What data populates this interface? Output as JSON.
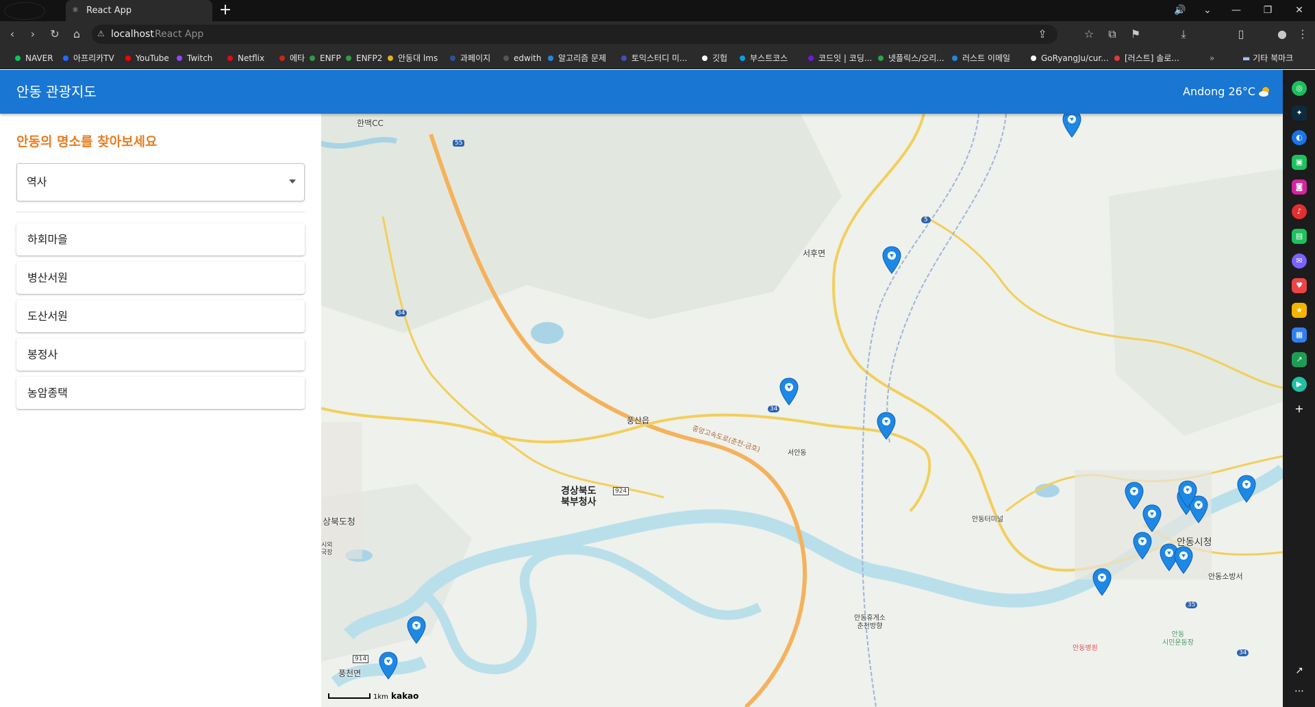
{
  "browser": {
    "tab_title": "React App",
    "url_host": "localhost",
    "url_title": "React App",
    "bookmarks": [
      {
        "label": "NAVER",
        "color": "#03c75a"
      },
      {
        "label": "아프리카TV",
        "color": "#1f6cff"
      },
      {
        "label": "YouTube",
        "color": "#ff0000"
      },
      {
        "label": "Twitch",
        "color": "#9146ff"
      },
      {
        "label": "Netflix",
        "color": "#e50914"
      },
      {
        "label": "에타",
        "color": "#c62917"
      },
      {
        "label": "ENFP",
        "color": "#2d9c4a"
      },
      {
        "label": "ENFP2",
        "color": "#2d9c4a"
      },
      {
        "label": "안동대 lms",
        "color": "#e0b020"
      },
      {
        "label": "과페이지",
        "color": "#3050a0"
      },
      {
        "label": "edwith",
        "color": "#555555"
      },
      {
        "label": "알고리즘 문제",
        "color": "#1e88e5"
      },
      {
        "label": "토익스터디 미...",
        "color": "#3f51b5"
      },
      {
        "label": "깃헙",
        "color": "#ffffff"
      },
      {
        "label": "부스트코스",
        "color": "#00a0e9"
      },
      {
        "label": "코드잇 | 코딩...",
        "color": "#6a1bde"
      },
      {
        "label": "넷플릭스/오리...",
        "color": "#2aa44a"
      },
      {
        "label": "러스트 이메일",
        "color": "#1e88e5"
      },
      {
        "label": "GoRyangJu/cur...",
        "color": "#ffffff"
      },
      {
        "label": "[러스트] 솔로...",
        "color": "#e53935"
      }
    ],
    "other_bookmarks": "기타 북마크"
  },
  "app": {
    "title": "안동 관광지도",
    "weather": "Andong 26°C",
    "sidebar_heading": "안동의 명소를 찾아보세요",
    "category_selected": "역사",
    "places": [
      "하회마을",
      "병산서원",
      "도산서원",
      "봉정사",
      "농암종택"
    ]
  },
  "map": {
    "labels": {
      "hanmaek": "한맥CC",
      "seohu": "서후면",
      "pungsan": "풍산읍",
      "seoandong": "서안동",
      "gb_north_1": "경상북도",
      "gb_north_2": "북부청사",
      "gb_province": "상북도청",
      "andong_terminal": "안동터미널",
      "andong_cityhall": "안동시청",
      "andong_fire": "안동소방서",
      "rest_area_1": "안동휴게소",
      "rest_area_2": "춘천방향",
      "hospital": "안동병원",
      "stadium_1": "안동",
      "stadium_2": "시민운동장",
      "pungcheon": "풍천면",
      "highway_name": "중앙고속도로(춘천-금호)",
      "local_1": "시외",
      "local_2": "국장",
      "road_55": "55",
      "road_5": "5",
      "road_34": "34",
      "road_924": "924",
      "road_914": "914",
      "road_35": "35"
    },
    "scale": "1km",
    "brand": "kakao",
    "marker_color": "#1e88e5"
  }
}
